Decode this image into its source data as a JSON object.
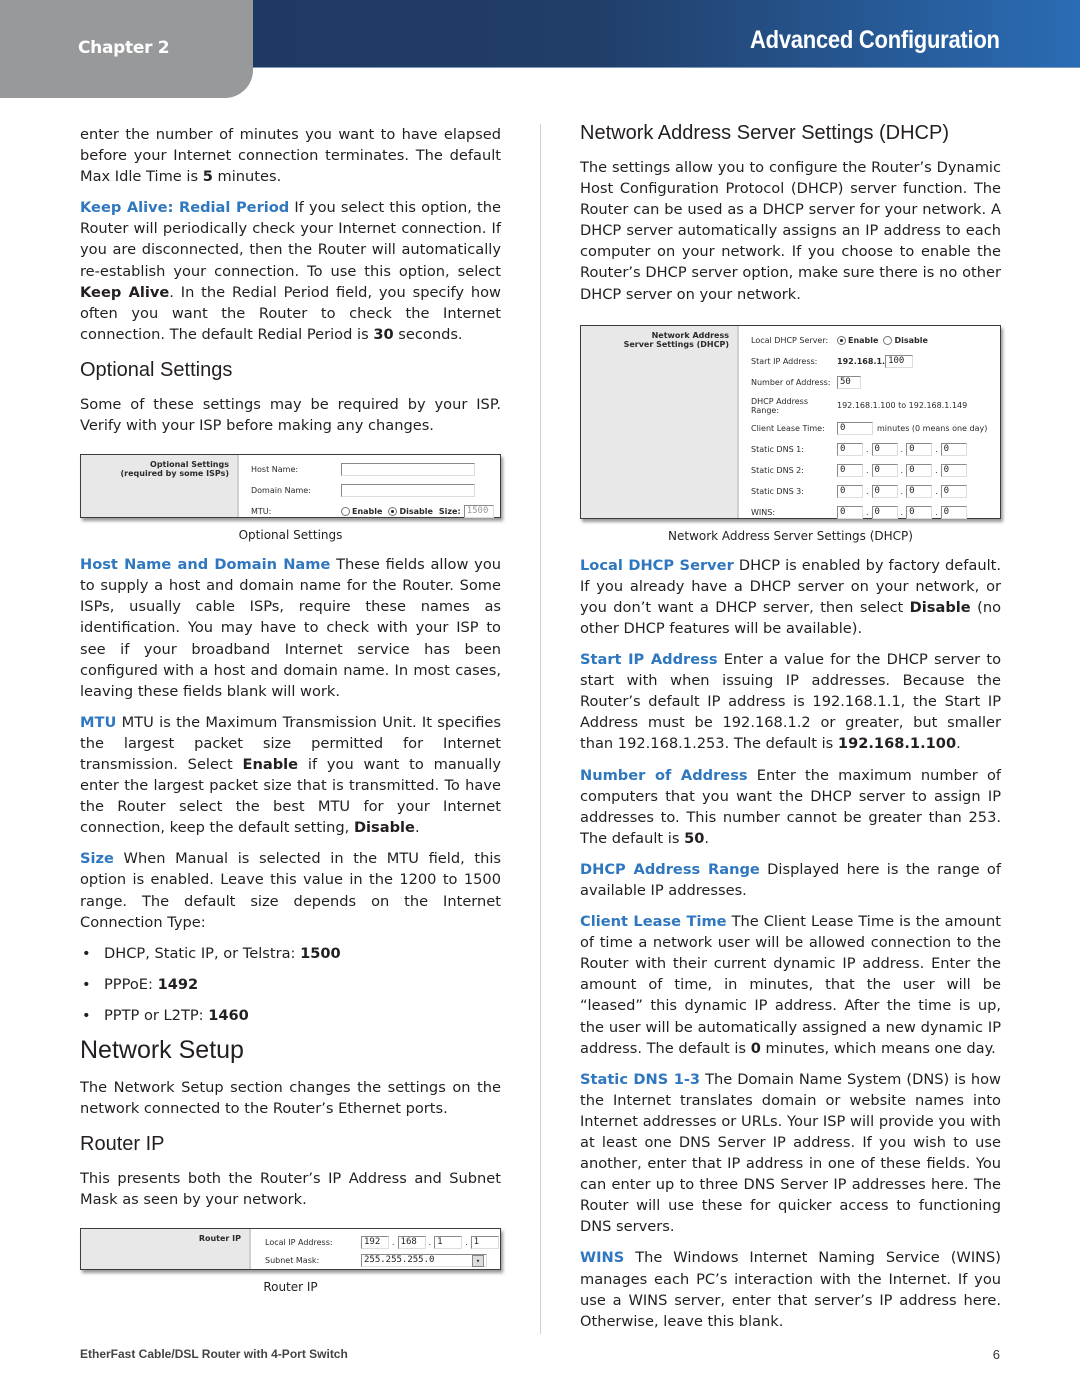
{
  "header": {
    "chapter": "Chapter 2",
    "title": "Advanced Configuration"
  },
  "left": {
    "intro": {
      "text1": "enter the number of minutes you want to have elapsed before your Internet connection terminates. The default Max Idle Time is ",
      "bold1": "5",
      "text2": " minutes."
    },
    "keep_alive": {
      "term": "Keep Alive: Redial Period",
      "text1": " If you select this option, the Router will periodically check your Internet connection. If you are disconnected, then the Router will automatically re-establish your connection. To use this option, select ",
      "bold1": "Keep Alive",
      "text2": ". In the Redial Period field, you specify how often you want the Router to check the Internet connection. The default Redial Period is ",
      "bold2": "30",
      "text3": " seconds."
    },
    "optional_heading": "Optional Settings",
    "optional_intro": "Some of these settings may be required by your ISP. Verify with your ISP before making any changes.",
    "optional_fig": {
      "section_title": "Optional Settings",
      "section_sub": "(required by some ISPs)",
      "host_label": "Host Name:",
      "host_value": "",
      "domain_label": "Domain Name:",
      "domain_value": "",
      "mtu_label": "MTU:",
      "enable_label": "Enable",
      "disable_label": "Disable",
      "size_label": "Size:",
      "size_value": "1500",
      "caption": "Optional Settings"
    },
    "host_name": {
      "term": "Host Name and Domain Name",
      "text": "  These fields allow you to supply a host and domain name for the Router. Some ISPs, usually cable ISPs, require these names as identification. You may have to check with your ISP to see if your broadband Internet service has been configured with a host and domain name. In most cases, leaving these fields blank will work."
    },
    "mtu": {
      "term": "MTU",
      "text1": "  MTU is the Maximum Transmission Unit. It specifies the largest packet size permitted for Internet transmission. Select ",
      "bold1": "Enable",
      "text2": " if you want to manually enter the largest packet size that is transmitted. To have the Router select the best MTU for your Internet connection, keep the default setting, ",
      "bold2": "Disable",
      "text3": "."
    },
    "size": {
      "term": "Size",
      "text": "  When Manual is selected in the MTU field, this option is enabled. Leave this value in the 1200 to 1500 range. The default size depends on the Internet Connection Type:"
    },
    "size_list": [
      {
        "label": "DHCP, Static IP, or Telstra: ",
        "value": "1500"
      },
      {
        "label": "PPPoE: ",
        "value": "1492"
      },
      {
        "label": "PPTP or L2TP: ",
        "value": "1460"
      }
    ],
    "network_setup_heading": "Network Setup",
    "network_setup_intro": "The Network Setup section changes the settings on the network connected to the Router’s Ethernet ports.",
    "router_ip_heading": "Router IP",
    "router_ip_intro": "This presents both the Router’s IP Address and Subnet Mask as seen by your network.",
    "router_ip_fig": {
      "section_title": "Router IP",
      "local_ip_label": "Local IP Address:",
      "ip": [
        "192",
        "168",
        "1",
        "1"
      ],
      "subnet_label": "Subnet Mask:",
      "subnet_value": "255.255.255.0",
      "caption": "Router IP"
    }
  },
  "right": {
    "dhcp_heading": "Network Address Server Settings (DHCP)",
    "dhcp_intro": "The settings allow you to configure the Router’s Dynamic Host Configuration Protocol (DHCP) server function. The Router can be used as a DHCP server for your network. A DHCP server automatically assigns an IP address to each computer on your network. If you choose to enable the Router’s DHCP server option, make sure there is no other DHCP server on your network.",
    "dhcp_fig": {
      "section_title": "Network Address",
      "section_sub": "Server Settings (DHCP)",
      "local_dhcp_label": "Local DHCP Server:",
      "enable_label": "Enable",
      "disable_label": "Disable",
      "start_ip_label": "Start IP Address:",
      "start_ip_prefix": "192.168.1.",
      "start_ip_value": "100",
      "num_label": "Number of Address:",
      "num_value": "50",
      "range_label": "DHCP Address Range:",
      "range_value": "192.168.1.100 to 192.168.1.149",
      "lease_label": "Client Lease Time:",
      "lease_value": "0",
      "lease_note": "minutes (0 means one day)",
      "dns_rows": [
        {
          "label": "Static DNS 1:",
          "octets": [
            "0",
            "0",
            "0",
            "0"
          ]
        },
        {
          "label": "Static DNS 2:",
          "octets": [
            "0",
            "0",
            "0",
            "0"
          ]
        },
        {
          "label": "Static DNS 3:",
          "octets": [
            "0",
            "0",
            "0",
            "0"
          ]
        },
        {
          "label": "WINS:",
          "octets": [
            "0",
            "0",
            "0",
            "0"
          ]
        }
      ],
      "caption": "Network Address Server Settings (DHCP)"
    },
    "local_dhcp": {
      "term": "Local DHCP Server",
      "text1": "  DHCP is enabled by factory default. If you already have a DHCP server on your network, or you don’t want a DHCP server, then select ",
      "bold1": "Disable",
      "text2": " (no other DHCP features will be available)."
    },
    "start_ip": {
      "term": "Start IP Address",
      "text1": "  Enter a value for the DHCP server to start with when issuing IP addresses. Because the Router’s default IP address is 192.168.1.1, the Start IP Address must be 192.168.1.2 or greater, but smaller than 192.168.1.253. The default is ",
      "bold1": "192.168.1.100",
      "text2": "."
    },
    "number_of_address": {
      "term": "Number of Address",
      "text1": " Enter the maximum number of computers that you want the DHCP server to assign IP addresses to. This number cannot be greater than 253. The default is ",
      "bold1": "50",
      "text2": "."
    },
    "dhcp_range": {
      "term": "DHCP Address Range",
      "text": " Displayed here is the range of available IP addresses."
    },
    "lease_time": {
      "term": "Client Lease Time",
      "text1": "  The Client Lease Time is the amount of time a network user will be allowed connection to the Router with their current dynamic IP address. Enter the amount of time, in minutes, that the user will be “leased” this dynamic IP address. After the time is up, the user will be automatically assigned a new dynamic IP address. The default is ",
      "bold1": "0",
      "text2": " minutes, which means one day."
    },
    "static_dns": {
      "term": "Static DNS 1-3",
      "text": "  The Domain Name System (DNS) is how the Internet translates domain or website names into Internet addresses or URLs. Your ISP will provide you with at least one DNS Server IP address. If you wish to use another, enter that IP address in one of these fields. You can enter up to three DNS Server IP addresses here. The Router will use these for quicker access to functioning DNS servers."
    },
    "wins": {
      "term": "WINS",
      "text": " The Windows Internet Naming Service (WINS) manages each PC’s interaction with the Internet. If you use a WINS server, enter that server’s IP address here. Otherwise, leave this blank."
    }
  },
  "footer": {
    "product": "EtherFast Cable/DSL Router with 4-Port Switch",
    "page": "6"
  }
}
